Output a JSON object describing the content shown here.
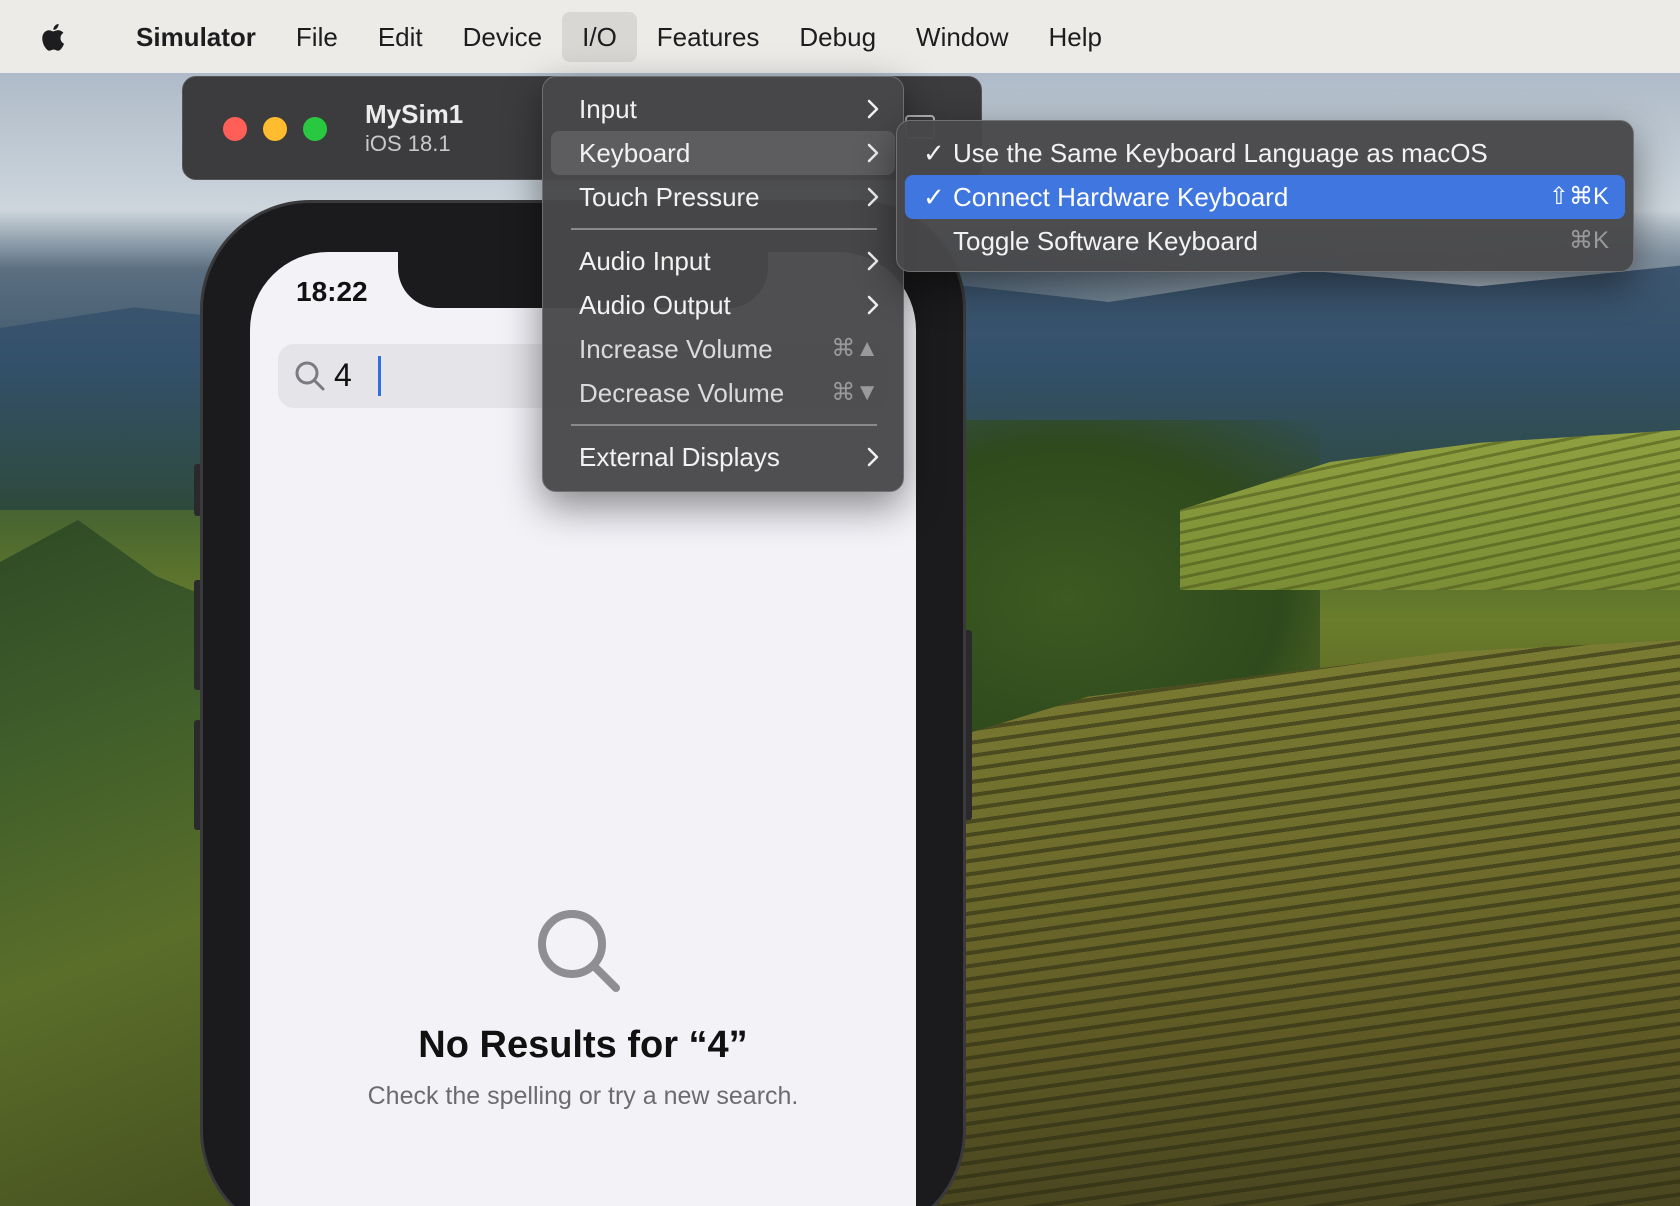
{
  "menubar": {
    "app_name": "Simulator",
    "items": [
      "File",
      "Edit",
      "Device",
      "I/O",
      "Features",
      "Debug",
      "Window",
      "Help"
    ],
    "open_menu": "I/O"
  },
  "simulator": {
    "device_name": "MySim1",
    "os_version": "iOS 18.1",
    "status_time": "18:22",
    "search_query": "4",
    "empty_title": "No Results for “4”",
    "empty_hint": "Check the spelling or try a new search."
  },
  "io_menu": {
    "input": "Input",
    "keyboard": "Keyboard",
    "touch_pressure": "Touch Pressure",
    "audio_input": "Audio Input",
    "audio_output": "Audio Output",
    "increase_volume": "Increase Volume",
    "increase_volume_shortcut": "⌘▲",
    "decrease_volume": "Decrease Volume",
    "decrease_volume_shortcut": "⌘▼",
    "external_displays": "External Displays"
  },
  "keyboard_menu": {
    "same_language": "Use the Same Keyboard Language as macOS",
    "same_language_checked": "✓",
    "connect_hardware": "Connect Hardware Keyboard",
    "connect_hardware_checked": "✓",
    "connect_hardware_shortcut": "⇧⌘K",
    "toggle_software": "Toggle Software Keyboard",
    "toggle_software_shortcut": "⌘K"
  },
  "colors": {
    "selection": "#3f76e0",
    "menu_bg": "#48484a",
    "caret": "#2f6fe0"
  },
  "icons": [
    "apple-logo",
    "chevron-right-icon",
    "search-icon",
    "checkmark-icon"
  ]
}
